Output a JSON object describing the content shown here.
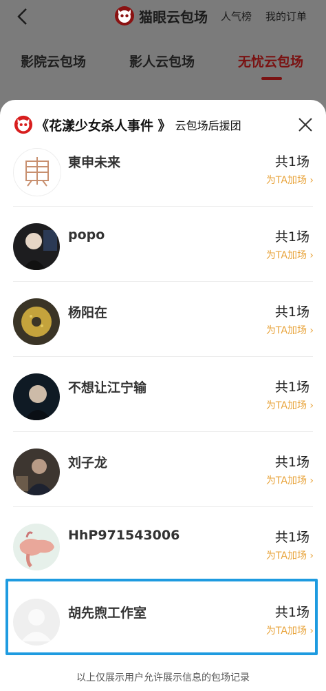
{
  "header": {
    "brand": "猫眼云包场",
    "links": [
      "人气榜",
      "我的订单"
    ]
  },
  "tabs": [
    {
      "label": "影院云包场",
      "active": false
    },
    {
      "label": "影人云包场",
      "active": false
    },
    {
      "label": "无忧云包场",
      "active": true
    }
  ],
  "modal": {
    "film_title": "《花漾少女杀人事件 》",
    "subtitle": "云包场后援团",
    "rows": [
      {
        "name": "東申未来",
        "count": "共1场",
        "action": "为TA加场 ›",
        "avatar": "logo-avatar"
      },
      {
        "name": "popo",
        "count": "共1场",
        "action": "为TA加场 ›",
        "avatar": "portrait-avatar"
      },
      {
        "name": "杨阳在",
        "count": "共1场",
        "action": "为TA加场 ›",
        "avatar": "donut-avatar"
      },
      {
        "name": "不想让江宁输",
        "count": "共1场",
        "action": "为TA加场 ›",
        "avatar": "portrait-avatar"
      },
      {
        "name": "刘子龙",
        "count": "共1场",
        "action": "为TA加场 ›",
        "avatar": "portrait-avatar"
      },
      {
        "name": "HhP971543006",
        "count": "共1场",
        "action": "为TA加场 ›",
        "avatar": "illustration-avatar"
      },
      {
        "name": "胡先煦工作室",
        "count": "共1场",
        "action": "为TA加场 ›",
        "avatar": "default-avatar"
      }
    ],
    "footnote": "以上仅展示用户允许展示信息的包场记录"
  },
  "colors": {
    "accent": "#7a1212",
    "action": "#e8a33a",
    "highlight": "#1e9be0"
  }
}
